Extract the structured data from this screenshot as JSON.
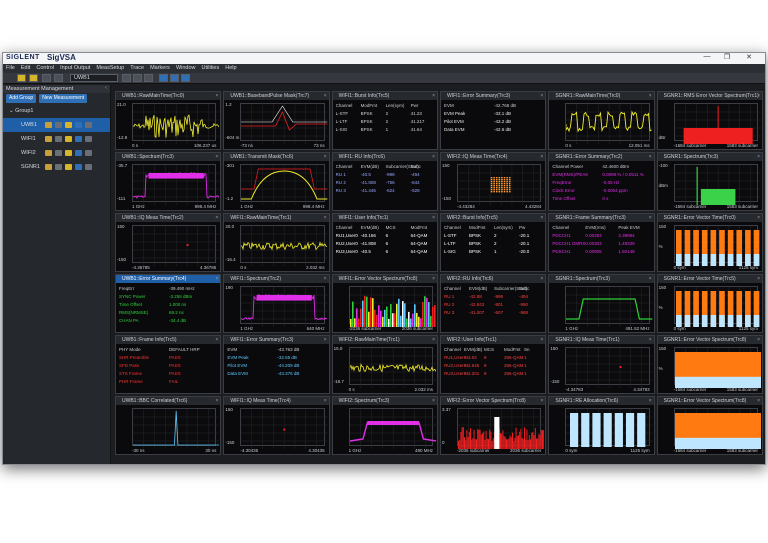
{
  "titlebar": {
    "brand": "SIGLENT",
    "app": "SigVSA",
    "controls": [
      "—",
      "❐",
      "✕"
    ]
  },
  "menu": [
    "File",
    "Edit",
    "Control",
    "Input Output",
    "MeasSetup",
    "Trace",
    "Markers",
    "Window",
    "Utilities",
    "Help"
  ],
  "toolbar": {
    "measurement_select": "UWB1"
  },
  "sidebar": {
    "title": "Measurement Management",
    "add_group": "Add Group",
    "new_measurement": "New Measurement",
    "group": "Group1",
    "items": [
      {
        "label": "UWB1",
        "selected": true
      },
      {
        "label": "WIFI1",
        "selected": false
      },
      {
        "label": "WIFI2",
        "selected": false
      },
      {
        "label": "SGNR1",
        "selected": false
      }
    ]
  },
  "colors": {
    "yellow": "#f2ee2a",
    "magenta": "#e12ee8",
    "green": "#2ed13a",
    "red": "#ee2020",
    "orange": "#ff7a10",
    "cyan": "#5ec8ff",
    "lightblue": "#bfe6ff"
  },
  "panes": [
    {
      "title": "UWB1::RawMainTime(Trc0)",
      "y": [
        "21.0",
        "",
        "-12.9"
      ],
      "x": [
        "0 s",
        "106.237 us"
      ]
    },
    {
      "title": "UWB1::BasebandPulse Mask(Trc7)",
      "y": [
        "1.2",
        "",
        "-604 m"
      ],
      "x": [
        "-73 ns",
        "73 ns"
      ]
    },
    {
      "title": "WIFI1::Burst Info(Trc5)",
      "table": [
        [
          "Channel",
          "ModFmt",
          "Len(sym)",
          "Pwr"
        ],
        [
          "L-STF",
          "BPSK",
          "2",
          "41.23"
        ],
        [
          "L-LTF",
          "BPSK",
          "2",
          "41.217"
        ],
        [
          "L-SIG",
          "BPSK",
          "1",
          "41.64"
        ]
      ]
    },
    {
      "title": "WIFI1::Error Summary(Trc3)",
      "table": [
        [
          "EVM",
          "-42.768 dB"
        ],
        [
          "EVM Peak",
          "-33.1 dB"
        ],
        [
          "Pilot EVM",
          "-43.2 dB"
        ],
        [
          "Data EVM",
          "-42.6 dB"
        ]
      ]
    },
    {
      "title": "SGNR1::RawMainTime(Trc0)",
      "y": [
        "",
        "",
        ""
      ],
      "x": [
        "0 s",
        "12.051 ms"
      ]
    },
    {
      "title": "SGNR1::RMS Error Vector Spectrum(Trc1)",
      "y": [
        "",
        "",
        "dBr"
      ],
      "x": [
        "-1584 subcarrier",
        "1583 subcarrier"
      ]
    },
    {
      "title": "UWB1::Spectrum(Trc3)",
      "y": [
        "-35.7",
        "",
        "-111"
      ],
      "x": [
        "1 GHz",
        "998.4 MHz"
      ]
    },
    {
      "title": "UWB1::Transmit Mask(Trc6)",
      "y": [
        "-301",
        "",
        "-1.2"
      ],
      "x": [
        "1 GHz",
        "998.4 MHz"
      ]
    },
    {
      "title": "WIFI1::RU Info(Trc6)",
      "table": [
        [
          "Channel",
          "EVM(dB)",
          "Subcarrier(Start)",
          "Subc"
        ],
        [
          "RU 1",
          "-40.5",
          "-998",
          "-494"
        ],
        [
          "RU 2",
          "-41.808",
          "-756",
          "-644"
        ],
        [
          "RU 3",
          "-41.445",
          "-624",
          "-528"
        ]
      ]
    },
    {
      "title": "WIFI2::IQ Meas Time(Trc4)",
      "y": [
        "150",
        "",
        "-150"
      ],
      "x": [
        "-4.43284",
        "4.43284"
      ]
    },
    {
      "title": "SGNR1::Error Summary(Trc2)",
      "table": [
        [
          "Channel Power",
          "42.4600 dBm"
        ],
        [
          "EVM(RMS)/PEAK",
          "0.0089 % / 0.0511 %"
        ],
        [
          "FreqError",
          "-0.05 Hz"
        ],
        [
          "Clock Error",
          "-0.0004 ppm"
        ],
        [
          "Time Offset",
          "0 s"
        ]
      ]
    },
    {
      "title": "SGNR1::Spectrum(Trc3)",
      "y": [
        "-100",
        "dBm",
        ""
      ],
      "x": [
        "-1584 subcarrier",
        "1583 subcarrier"
      ]
    },
    {
      "title": "UWB1::IQ Meas Time(Trc2)",
      "y": [
        "150",
        "",
        "-150"
      ],
      "x": [
        "-4.36785",
        "4.36785"
      ]
    },
    {
      "title": "WIFI1::RawMainTime(Trc1)",
      "y": [
        "20.0",
        "",
        "-16.4"
      ],
      "x": [
        "0 s",
        "2.032 ms"
      ]
    },
    {
      "title": "WIFI1::User Info(Trc1)",
      "table": [
        [
          "Channel",
          "EVM(dB)",
          "MCS",
          "ModFmt"
        ],
        [
          "RU1,User0",
          "-40.166",
          "6",
          "64-QAM"
        ],
        [
          "RU2,User0",
          "-41.808",
          "6",
          "64-QAM"
        ],
        [
          "RU3,User0",
          "-40.5",
          "6",
          "64-QAM"
        ]
      ]
    },
    {
      "title": "WIFI2::Burst Info(Trc5)",
      "table": [
        [
          "Channel",
          "ModFmt",
          "Len(sym)",
          "Pw"
        ],
        [
          "L-STF",
          "BPSK",
          "2",
          "-20.1"
        ],
        [
          "L-LTF",
          "BPSK",
          "2",
          "-20.1"
        ],
        [
          "L-SIG",
          "BPSK",
          "1",
          "-20.0"
        ]
      ]
    },
    {
      "title": "SGNR1::Frame Summary(Trc3)",
      "table": [
        [
          "Channel",
          "EVM(rms)",
          "Peak EVM"
        ],
        [
          "PDCCH1",
          "0.00393",
          "2.39994"
        ],
        [
          "PDCCH1 DMRS",
          "0.00303",
          "1.49339"
        ],
        [
          "PDSCH1",
          "0.00905",
          "1.50148"
        ]
      ]
    },
    {
      "title": "SGNR1::Error Vector Time(Trc0)",
      "y": [
        "150",
        "%",
        ""
      ],
      "x": [
        "0 sym",
        "1125 sym"
      ]
    },
    {
      "title": "UWB1::Error Summary(Trc4)",
      "table": [
        [
          "FreqErr",
          "-39.490 mHz"
        ],
        [
          "SYNC Power",
          "-3.256 dBm"
        ],
        [
          "Time Offset",
          "1.000 ns"
        ],
        [
          "RMS(NRMSE)",
          "69.2 ns"
        ],
        [
          "CHAN PA",
          "-34.4 dB"
        ]
      ]
    },
    {
      "title": "WIFI1::Spectrum(Trc2)",
      "y": [
        "190",
        "",
        ""
      ],
      "x": [
        "1 GHz",
        "640 MHz"
      ]
    },
    {
      "title": "WIFI1::Error Vector Spectrum(Trc8)",
      "y": [
        "",
        "",
        ""
      ],
      "x": [
        "-2036 subcarrier",
        "2036 subcarrier"
      ]
    },
    {
      "title": "WIFI2::RU Info(Trc6)",
      "table": [
        [
          "Channel",
          "EVM(dB)",
          "Subcarrier(Start)",
          "Subc"
        ],
        [
          "RU 1",
          "-42.88",
          "-998",
          "-494"
        ],
        [
          "RU 2",
          "-42.843",
          "-801",
          "-990"
        ],
        [
          "RU 3",
          "-41.207",
          "-607",
          "-988"
        ]
      ]
    },
    {
      "title": "SGNR1::Spectrum(Trc3)",
      "y": [
        "",
        "",
        ""
      ],
      "x": [
        "1 GHz",
        "491.52 MHz"
      ]
    },
    {
      "title": "SGNR1::Error Vector Time(Trc5)",
      "y": [
        "150",
        "%",
        ""
      ],
      "x": [
        "0 sym",
        "1125 sym"
      ]
    },
    {
      "title": "UWB1::Frame Info(Trc5)",
      "table": [
        [
          "PHY Mode",
          "DEFAULT HRP"
        ],
        [
          "SHR Preamble",
          "PASS"
        ],
        [
          "SFD Pass",
          "PASS"
        ],
        [
          "STS Frame",
          "PASS"
        ],
        [
          "PHR Frame",
          "FAIL"
        ]
      ]
    },
    {
      "title": "WIFI1::Error Summary(Trc3)",
      "table": [
        [
          "EVM",
          "-43.763 dB"
        ],
        [
          "EVM Peak",
          "-32.55 dB"
        ],
        [
          "Pilot EVM",
          "-44.209 dB"
        ],
        [
          "Data EVM",
          "-43.376 dB"
        ]
      ]
    },
    {
      "title": "WIFI2::RawMainTime(Trc1)",
      "y": [
        "15.0",
        "",
        "-18.7"
      ],
      "x": [
        "0 s",
        "2.032 ms"
      ]
    },
    {
      "title": "WIFI2::User Info(Trc1)",
      "table": [
        [
          "Channel",
          "EVM(dB)",
          "MCS",
          "ModFmt",
          "Sn"
        ],
        [
          "RU1,User0",
          "-43.04",
          "8",
          "256-QAM",
          "1"
        ],
        [
          "RU2,User0",
          "-42.645",
          "8",
          "256-QAM",
          "1"
        ],
        [
          "RU3,User0",
          "-42.201",
          "8",
          "256-QAM",
          "1"
        ]
      ]
    },
    {
      "title": "SGNR1::IQ Meas Time(Trc1)",
      "y": [
        "150",
        "",
        "-150"
      ],
      "x": [
        "-4.34783",
        "4.34783"
      ]
    },
    {
      "title": "SGNR1::Error Vector Spectrum(Trc8)",
      "y": [
        "150",
        "%",
        ""
      ],
      "x": [
        "-1584 subcarrier",
        "1583 subcarrier"
      ]
    },
    {
      "title": "UWB1::BBC Correlated(Trc6)",
      "y": [
        "",
        "",
        ""
      ],
      "x": [
        "-30 ns",
        "30 ns"
      ]
    },
    {
      "title": "WIFI1::IQ Meas Time(Trc4)",
      "y": [
        "150",
        "",
        "-150"
      ],
      "x": [
        "-4.30435",
        "4.30435"
      ]
    },
    {
      "title": "WIFI2::Spectrum(Trc3)",
      "y": [
        "",
        "",
        ""
      ],
      "x": [
        "1 GHz",
        "480 MHz"
      ]
    },
    {
      "title": "WIFI2::Error Vector Spectrum(Trc8)",
      "y": [
        "3.37",
        "",
        "0"
      ],
      "x": [
        "-2036 subcarrier",
        "2036 subcarrier"
      ]
    },
    {
      "title": "SGNR1::RE Allocation(Trc6)",
      "y": [
        "",
        "",
        ""
      ],
      "x": [
        "0 sym",
        "1125 sym"
      ]
    },
    {
      "title": "SGNR1::Error Vector Spectrum(Trc8)",
      "y": [
        "",
        "",
        ""
      ],
      "x": [
        "-1584 subcarrier",
        "1583 subcarrier"
      ]
    }
  ]
}
